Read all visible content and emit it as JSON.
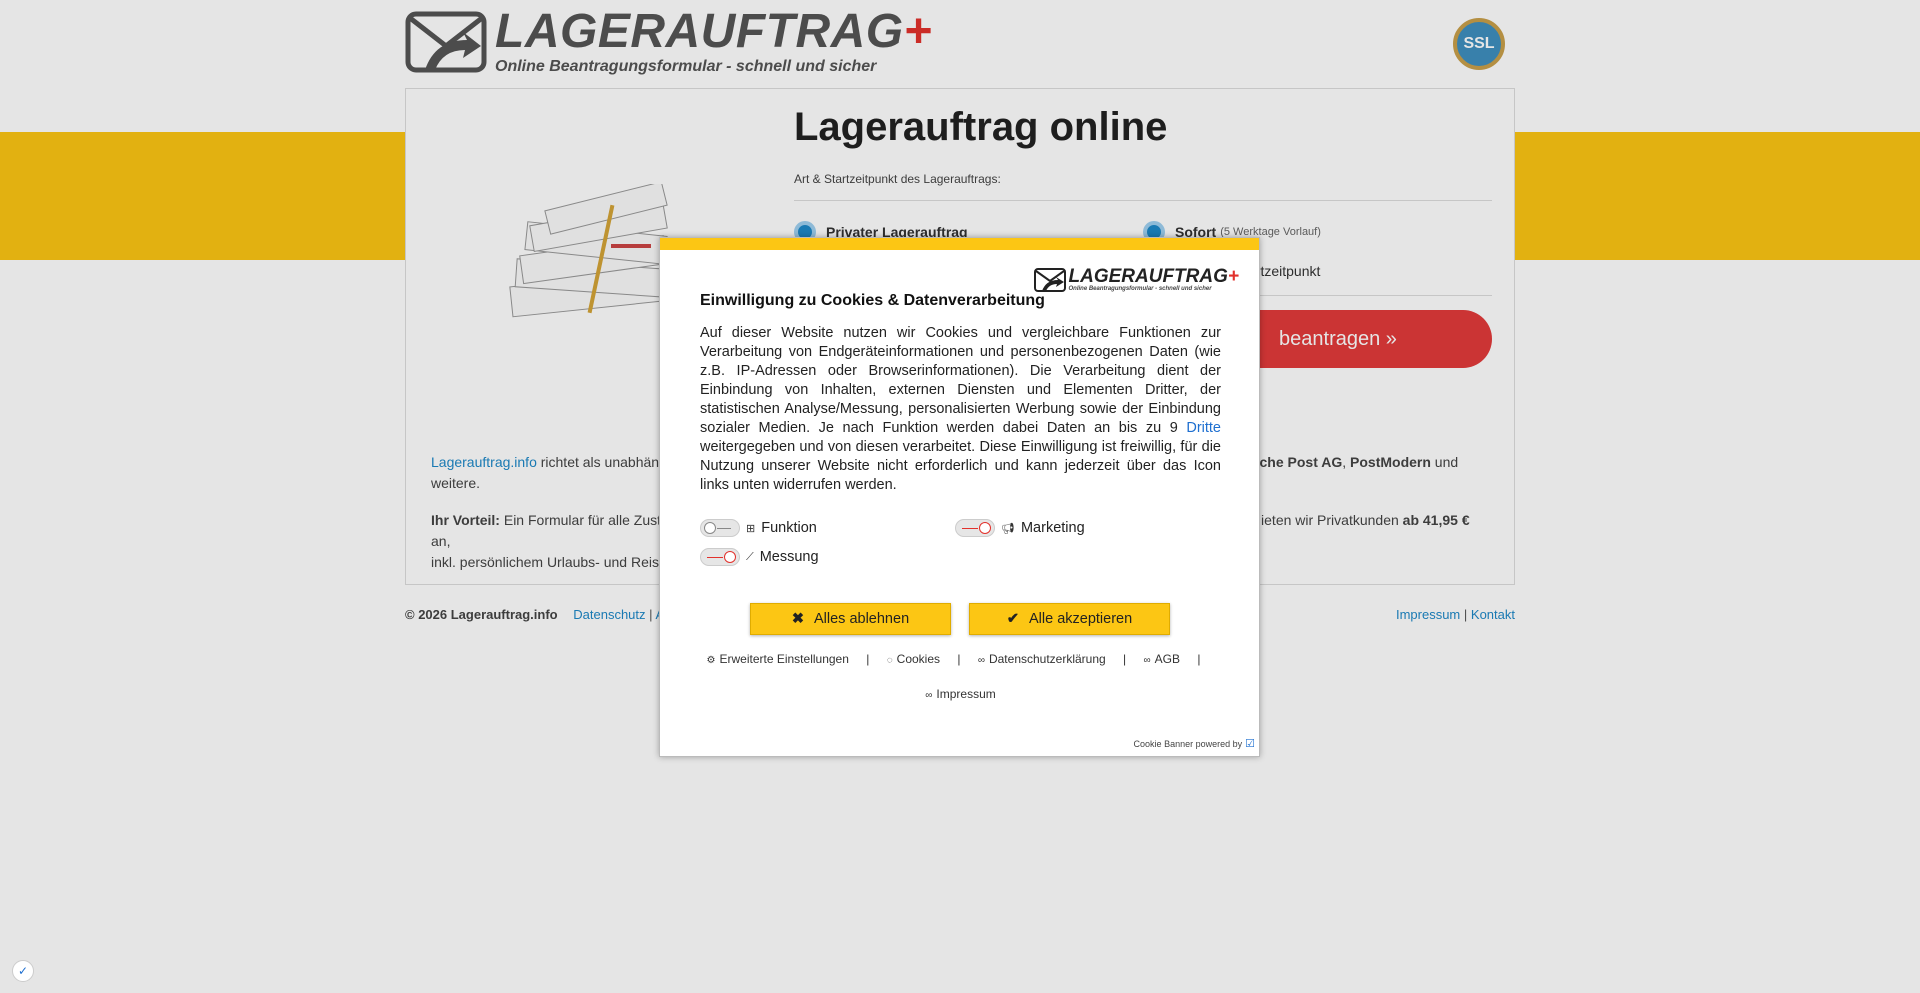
{
  "header": {
    "logo_title": "LAGERAUFTRAG",
    "logo_plus": "+",
    "logo_sub": "Online Beantragungsformular - schnell und sicher",
    "ssl_label": "SSL"
  },
  "main": {
    "title": "Lagerauftrag online",
    "subtitle": "Art & Startzeitpunkt des Lagerauftrags:",
    "option1_label": "Privater Lagerauftrag",
    "option2_label": "Sofort",
    "option2_small": "(5 Werktage Vorlauf)",
    "option3_partial": "artzeitpunkt",
    "cta_partial": "beantragen »",
    "info1_link": "Lagerauftrag.info",
    "info1_text_a": " richtet als unabhän",
    "info1_text_b": "tsche Post AG",
    "info1_text_c": ", ",
    "info1_text_d": "PostModern",
    "info1_text_e": " und",
    "info1_line2": "weitere.",
    "info2_bold": "Ihr Vorteil:",
    "info2_text_a": " Ein Formular für alle Zust",
    "info2_text_b": "ieten wir Privatkunden ",
    "info2_price": "ab 41,95 €",
    "info2_text_c": " an,",
    "info2_line2": "inkl. persönlichem Urlaubs- und Reis"
  },
  "footer": {
    "copyright": "© 2026 Lagerauftrag.info",
    "link_datenschutz": "Datenschutz",
    "sep": "|",
    "link_a_partial": "A",
    "link_impressum": "Impressum",
    "link_kontakt": "Kontakt"
  },
  "modal": {
    "logo_title": "LAGERAUFTRAG",
    "logo_plus": "+",
    "logo_sub": "Online Beantragungsformular - schnell und sicher",
    "title": "Einwilligung zu Cookies & Datenverarbeitung",
    "text_before_link": "Auf dieser Website nutzen wir Cookies und vergleichbare Funktionen zur Verarbeitung von Endgeräteinformationen und personenbezogenen Daten (wie z.B. IP-Adressen oder Browserinformationen). Die Verarbeitung dient der Einbindung von Inhalten, externen Diensten und Elementen Dritter, der statistischen Analyse/Messung, personalisierten Werbung sowie der Einbindung sozialer Medien. Je nach Funktion werden dabei Daten an bis zu 9 ",
    "text_link": "Dritte",
    "text_after_link": " weitergegeben und von diesen verarbeitet. Diese Einwilligung ist freiwillig, für die Nutzung unserer Website nicht erforderlich und kann jederzeit über das Icon links unten widerrufen werden.",
    "toggles": {
      "funktion": "Funktion",
      "marketing": "Marketing",
      "messung": "Messung"
    },
    "btn_reject": "Alles ablehnen",
    "btn_accept": "Alle akzeptieren",
    "link_settings": "Erweiterte Einstellungen",
    "link_cookies": "Cookies",
    "link_privacy": "Datenschutzerklärung",
    "link_agb": "AGB",
    "link_impressum": "Impressum",
    "sep": "|",
    "powered": "Cookie Banner powered by"
  },
  "colors": {
    "accent_yellow": "#fcc614",
    "link_blue": "#1e88c8",
    "brand_red": "#e2312c"
  }
}
